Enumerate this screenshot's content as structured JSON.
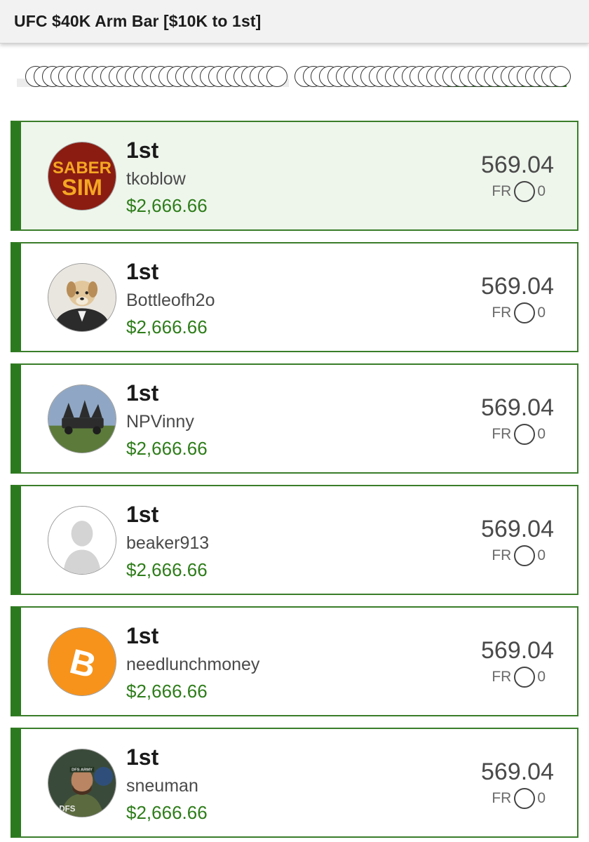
{
  "header": {
    "title": "UFC $40K Arm Bar [$10K to 1st]"
  },
  "entries": [
    {
      "rank": "1st",
      "username": "tkoblow",
      "prize": "$2,666.66",
      "score": "569.04",
      "fr_label": "FR",
      "fr_value": "0",
      "avatar": "sabersim-logo",
      "avatar_text": [
        "SABER",
        "SIM"
      ]
    },
    {
      "rank": "1st",
      "username": "Bottleofh2o",
      "prize": "$2,666.66",
      "score": "569.04",
      "fr_label": "FR",
      "fr_value": "0",
      "avatar": "dog-in-suit-photo"
    },
    {
      "rank": "1st",
      "username": "NPVinny",
      "prize": "$2,666.66",
      "score": "569.04",
      "fr_label": "FR",
      "fr_value": "0",
      "avatar": "chariot-statue-photo"
    },
    {
      "rank": "1st",
      "username": "beaker913",
      "prize": "$2,666.66",
      "score": "569.04",
      "fr_label": "FR",
      "fr_value": "0",
      "avatar": "default-user-silhouette"
    },
    {
      "rank": "1st",
      "username": "needlunchmoney",
      "prize": "$2,666.66",
      "score": "569.04",
      "fr_label": "FR",
      "fr_value": "0",
      "avatar": "bitcoin-logo",
      "avatar_text": [
        "B"
      ]
    },
    {
      "rank": "1st",
      "username": "sneuman",
      "prize": "$2,666.66",
      "score": "569.04",
      "fr_label": "FR",
      "fr_value": "0",
      "avatar": "dfs-army-soldier",
      "avatar_text": [
        "DFS ARMY",
        "DFS"
      ]
    }
  ],
  "colors": {
    "accent": "#2c7a1f",
    "prize_text": "#2e7d1a",
    "highlight_bg": "#eef6ec"
  }
}
